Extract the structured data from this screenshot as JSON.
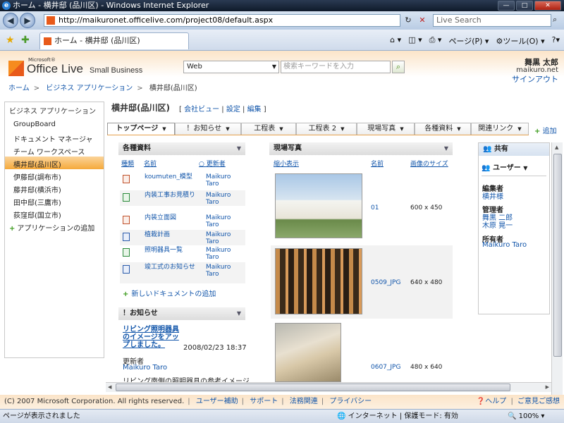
{
  "browser": {
    "title": "ホーム - 横井邸 (品川区) - Windows Internet Explorer",
    "url": "http://maikuronet.officelive.com/project08/default.aspx",
    "search_placeholder": "Live Search",
    "tab_title": "ホーム - 横井邸 (品川区)",
    "cmd_page": "ページ(P)",
    "cmd_tools": "ツール(O)",
    "status_text": "ページが表示されました",
    "status_zone": "インターネット | 保護モード: 有効",
    "status_zoom": "100%"
  },
  "header": {
    "logo_microsoft": "Microsoft®",
    "logo_office_live": "Office Live",
    "logo_small_business": "Small Business",
    "search_scope": "Web",
    "search_placeholder": "検索キーワードを入力",
    "user_name": "舞黒 太郎",
    "user_domain": "maikuro.net",
    "signout": "サインアウト"
  },
  "breadcrumb": [
    "ホーム",
    "ビジネス アプリケーション",
    "横井邸(品川区)"
  ],
  "leftnav": {
    "title": "ビジネス アプリケーション",
    "items": [
      {
        "label": "GroupBoard"
      },
      {
        "label": "ドキュメント マネージャ"
      },
      {
        "label": "チーム ワークスペース"
      },
      {
        "label": "横井邸(品川区)"
      },
      {
        "label": "伊藤邸(調布市)"
      },
      {
        "label": "藤井邸(横浜市)"
      },
      {
        "label": "田中邸(三鷹市)"
      },
      {
        "label": "荻窪邸(国立市)"
      }
    ],
    "add_label": "アプリケーションの追加"
  },
  "site": {
    "title": "横井邸(品川区)",
    "links": [
      "会社ビュー",
      "設定",
      "編集"
    ]
  },
  "tabs": [
    {
      "label": "トップページ"
    },
    {
      "label": "！お知らせ"
    },
    {
      "label": "工程表"
    },
    {
      "label": "工程表 2"
    },
    {
      "label": "現場写真"
    },
    {
      "label": "各種資料"
    },
    {
      "label": "関連リンク"
    }
  ],
  "add_page": "追加",
  "docs": {
    "title": "各種資料",
    "col_type": "種類",
    "col_name": "名前",
    "col_editor": "更新者",
    "rows": [
      {
        "name": "koumuten_模型",
        "editor": "Maikuro Taro",
        "kind": "ppt"
      },
      {
        "name": "内装工事お見積り",
        "editor": "Maikuro Taro",
        "kind": "xls"
      },
      {
        "name": "内装立面図",
        "editor": "Maikuro Taro",
        "kind": "ppt"
      },
      {
        "name": "植栽計画",
        "editor": "Maikuro Taro",
        "kind": "doc"
      },
      {
        "name": "照明器具一覧",
        "editor": "Maikuro Taro",
        "kind": "xls"
      },
      {
        "name": "竣工式のお知らせ",
        "editor": "Maikuro Taro",
        "kind": "doc"
      }
    ],
    "add_label": "新しいドキュメントの追加"
  },
  "announcements": {
    "title": "！お知らせ",
    "item_title": "リビング照明器具のイメージをアップしました。",
    "item_date": "2008/02/23 18:37",
    "editor_label": "更新者",
    "editor": "Maikuro Taro",
    "body": "リビング南側の照明器具の参考イメージ"
  },
  "photos": {
    "title": "現場写真",
    "col_thumb": "縮小表示",
    "col_name": "名前",
    "col_size": "画像のサイズ",
    "rows": [
      {
        "name": "01",
        "size": "600 x 450"
      },
      {
        "name": "0509_JPG",
        "size": "640 x 480"
      },
      {
        "name": "0607_JPG",
        "size": "480 x 640"
      }
    ]
  },
  "shared": {
    "title": "共有",
    "user_menu": "ユーザー",
    "groups": [
      {
        "role": "編集者",
        "people": [
          "横井様"
        ]
      },
      {
        "role": "管理者",
        "people": [
          "舞黒 二郎",
          "木原 晃一"
        ]
      },
      {
        "role": "所有者",
        "people": [
          "Maikuro Taro"
        ]
      }
    ]
  },
  "footer": {
    "copyright": "(C) 2007 Microsoft Corporation. All rights reserved.",
    "links": [
      "ユーザー補助",
      "サポート",
      "法務関連",
      "プライバシー"
    ],
    "help": "ヘルプ",
    "feedback": "ご意見ご感想"
  }
}
